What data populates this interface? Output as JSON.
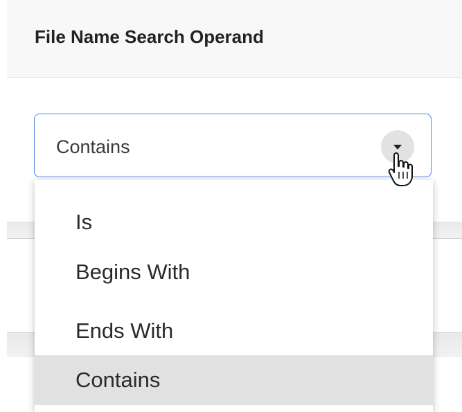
{
  "header": {
    "title": "File Name Search Operand"
  },
  "select": {
    "value": "Contains",
    "arrow_icon": "caret-down-icon"
  },
  "dropdown": {
    "options": [
      {
        "label": "Is"
      },
      {
        "label": "Begins With"
      },
      {
        "label": "Ends With"
      },
      {
        "label": "Contains",
        "selected": true
      }
    ]
  },
  "colors": {
    "focus_border": "#4a86e8",
    "selected_option_bg": "#e1e1e1",
    "header_bg": "#f8f8f8"
  },
  "cursor_icon": "hand-pointer-icon"
}
